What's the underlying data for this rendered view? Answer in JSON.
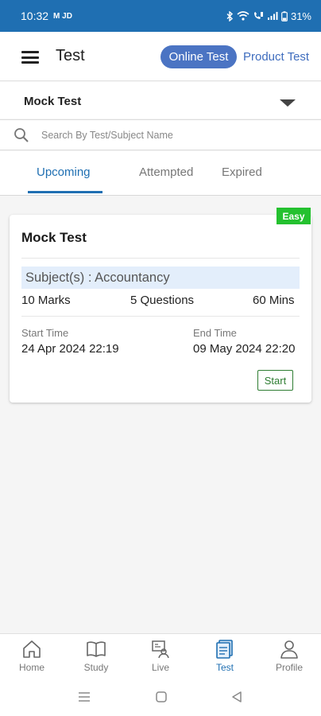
{
  "status_bar": {
    "time": "10:32",
    "left_icons": "M JD",
    "battery": "31%"
  },
  "header": {
    "title": "Test",
    "toggle_online": "Online Test",
    "toggle_product": "Product Test"
  },
  "selector": {
    "value": "Mock Test"
  },
  "search": {
    "placeholder": "Search By Test/Subject Name"
  },
  "tabs": [
    {
      "label": "Upcoming",
      "active": true
    },
    {
      "label": "Attempted",
      "active": false
    },
    {
      "label": "Expired",
      "active": false
    }
  ],
  "test_card": {
    "difficulty": "Easy",
    "title": "Mock Test",
    "subject": "Subject(s) : Accountancy",
    "marks": "10 Marks",
    "questions": "5 Questions",
    "duration": "60 Mins",
    "start_label": "Start Time",
    "start_value": "24 Apr 2024 22:19",
    "end_label": "End Time",
    "end_value": "09 May 2024 22:20",
    "start_button": "Start"
  },
  "bottom_nav": [
    {
      "label": "Home",
      "icon": "home-icon",
      "active": false
    },
    {
      "label": "Study",
      "icon": "book-icon",
      "active": false
    },
    {
      "label": "Live",
      "icon": "live-icon",
      "active": false
    },
    {
      "label": "Test",
      "icon": "test-icon",
      "active": true
    },
    {
      "label": "Profile",
      "icon": "profile-icon",
      "active": false
    }
  ],
  "colors": {
    "primary": "#1f6fb2",
    "toggle_active": "#4b74c3",
    "easy_badge": "#24c12f",
    "start_button": "#2e7d32",
    "subject_bg": "#e3eefb"
  }
}
